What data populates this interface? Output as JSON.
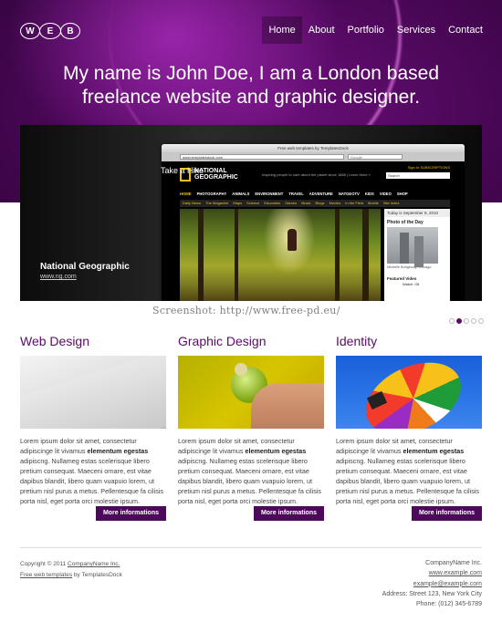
{
  "header": {
    "logo_letters": [
      "W",
      "E",
      "B"
    ],
    "nav": [
      {
        "label": "Home",
        "active": true
      },
      {
        "label": "About",
        "active": false
      },
      {
        "label": "Portfolio",
        "active": false
      },
      {
        "label": "Services",
        "active": false
      },
      {
        "label": "Contact",
        "active": false
      }
    ],
    "tagline_line1": "My name is John Doe, I am a London based",
    "tagline_line2": "freelance website and graphic designer."
  },
  "slider": {
    "title": "National Geographic",
    "url": "www.ng.com",
    "browser_title": "Free web templates by TemplatesDock",
    "address": "www.templatesdock.com",
    "search_placeholder": "Google",
    "site": {
      "logo_line1": "NATIONAL",
      "logo_line2": "GEOGRAPHIC",
      "tag": "Inspiring people to care about the planet since 1888 | Learn More »",
      "subscriptions": "Sign In   SUBSCRIPTIONS",
      "search": "Search",
      "nav": [
        "HOME",
        "PHOTOGRAPHY",
        "ANIMALS",
        "ENVIRONMENT",
        "TRAVEL",
        "ADVENTURE",
        "NATGEOTV",
        "KIDS",
        "VIDEO",
        "SHOP"
      ],
      "subnav": [
        "Daily News",
        "The Magazine",
        "Maps",
        "Science",
        "Education",
        "Games",
        "Music",
        "Blogs",
        "Movies",
        "In the Field",
        "Mobile",
        "Site Index"
      ],
      "date": "Today is September 8, 2010",
      "photo_of_day": "Photo of the Day",
      "photo_caption": "Michelle Bridgeway, Chicago",
      "featured_video": "Featured Video",
      "featured_video_item": "Watch: Oil",
      "photo_caption_main": "Take a Hike"
    },
    "watermark": "Screenshot: http://www.free-pd.eu/",
    "dots": [
      false,
      true,
      false,
      false,
      false
    ]
  },
  "columns": [
    {
      "title": "Web Design",
      "text_before": "Lorem ipsum dolor sit amet, consectetur adipiscinge lit vivamus ",
      "text_bold": "elementum egestas",
      "text_after": " adipiscng. Nullameg estas scelerisque libero pretium consequat. Maeceni ornare, est vitae dapibus blandit, libero quam vuapuio lorem, ut pretium nisl purus a metus. Pellentesque fa cilisis porta nisl, eget porta orci molestie ipsum.",
      "button": "More informations"
    },
    {
      "title": "Graphic Design",
      "text_before": "Lorem ipsum dolor sit amet, consectetur adipiscinge lit vivamus ",
      "text_bold": "elementum egestas",
      "text_after": " adipiscng. Nullameg estas scelerisque libero pretium consequat. Maeceni ornare, est vitae dapibus blandit, libero quam vuapuio lorem, ut pretium nisl purus a metus. Pellentesque fa cilisis porta nisl, eget porta orci molestie ipsum.",
      "button": "More informations"
    },
    {
      "title": "Identity",
      "text_before": "Lorem ipsum dolor sit amet, consectetur adipiscinge lit vivamus ",
      "text_bold": "elementum egestas",
      "text_after": " adipiscng. Nullameg estas scelerisque libero pretium consequat. Maeceni ornare, est vitae dapibus blandit, libero quam vuapuio lorem, ut pretium nisl purus a metus. Pellentesque fa cilisis porta nisl, eget porta orci molestie ipsum.",
      "button": "More informations"
    }
  ],
  "footer": {
    "copyright_prefix": "Copyright © 2011 ",
    "company_link": "CompanyName Inc.",
    "templates_link": "Free web templates",
    "templates_suffix": " by TemplatesDock",
    "contact": {
      "company": "CompanyName Inc.",
      "website": "www.example.com",
      "email": "example@example.com",
      "address": "Address: Street 123, New York City",
      "phone": "Phone: (012) 345-6789"
    }
  },
  "colors": {
    "brand_purple": "#5a0b67",
    "button_purple": "#4d0a5a"
  }
}
